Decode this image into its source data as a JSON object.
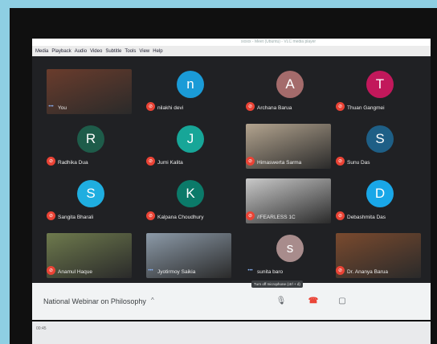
{
  "window": {
    "title": "xxxxx - Meet (Ubuntu) - VLC media player"
  },
  "menu": [
    "Media",
    "Playback",
    "Audio",
    "Video",
    "Subtitle",
    "Tools",
    "View",
    "Help"
  ],
  "participants": [
    {
      "name": "You",
      "letter": "",
      "color": "#6a3c2c",
      "video": true,
      "mic": "active"
    },
    {
      "name": "nilakhi devi",
      "letter": "n",
      "color": "#1a9bd7",
      "mic": "muted"
    },
    {
      "name": "Archana Barua",
      "letter": "A",
      "color": "#a46b6b",
      "mic": "muted"
    },
    {
      "name": "Thuan Gangmei",
      "letter": "T",
      "color": "#c2185b",
      "mic": "muted"
    },
    {
      "name": "Radhika Dua",
      "letter": "R",
      "color": "#1e5c4a",
      "mic": "muted"
    },
    {
      "name": "Jumi Kalita",
      "letter": "J",
      "color": "#17a698",
      "mic": "muted"
    },
    {
      "name": "Himaswerta Sarma",
      "letter": "",
      "color": "#b3a48f",
      "video": true,
      "mic": "muted"
    },
    {
      "name": "Sunu Das",
      "letter": "S",
      "color": "#1e5f86",
      "mic": "muted"
    },
    {
      "name": "Sangita Bharali",
      "letter": "S",
      "color": "#1faee0",
      "mic": "muted"
    },
    {
      "name": "Kalpana Choudhury",
      "letter": "K",
      "color": "#0b7a69",
      "mic": "muted"
    },
    {
      "name": "//FEARLESS 1C",
      "letter": "",
      "color": "#c9c9c9",
      "video": true,
      "mic": "muted"
    },
    {
      "name": "Debashmita Das",
      "letter": "D",
      "color": "#19a7e8",
      "mic": "muted"
    },
    {
      "name": "Anamul Haque",
      "letter": "",
      "color": "#6e7a4d",
      "video": true,
      "mic": "muted"
    },
    {
      "name": "Jyotirmoy Saikia",
      "letter": "",
      "color": "#8c9aa8",
      "video": true,
      "mic": "active"
    },
    {
      "name": "sunita baro",
      "letter": "s",
      "color": "#a88c8c",
      "mic": "active"
    },
    {
      "name": "Dr. Ananya Barua",
      "letter": "",
      "color": "#7a4a2e",
      "video": true,
      "mic": "muted"
    }
  ],
  "tooltip": "Turn off microphone (ctrl + d)",
  "meeting": {
    "title": "National Webinar on Philosophy"
  },
  "player": {
    "time": "00:45"
  }
}
